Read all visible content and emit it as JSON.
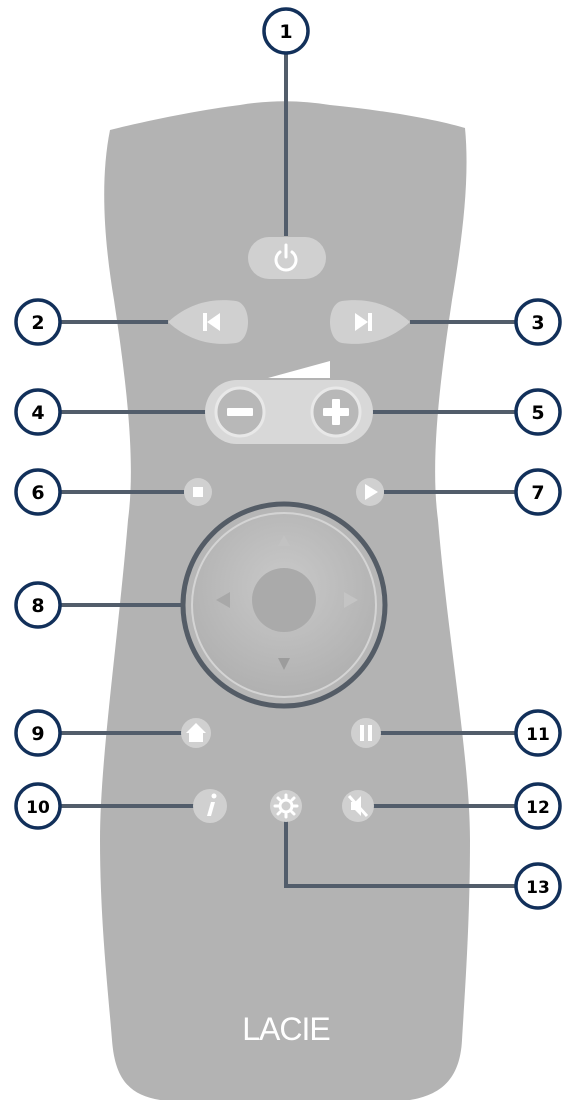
{
  "brand": {
    "logo_text": "LACIE"
  },
  "callouts": [
    {
      "number": "1",
      "target": "power-button"
    },
    {
      "number": "2",
      "target": "previous-button"
    },
    {
      "number": "3",
      "target": "next-button"
    },
    {
      "number": "4",
      "target": "volume-down-button"
    },
    {
      "number": "5",
      "target": "volume-up-button"
    },
    {
      "number": "6",
      "target": "stop-button"
    },
    {
      "number": "7",
      "target": "play-button"
    },
    {
      "number": "8",
      "target": "navigation-pad"
    },
    {
      "number": "9",
      "target": "home-button"
    },
    {
      "number": "10",
      "target": "info-button"
    },
    {
      "number": "11",
      "target": "pause-button"
    },
    {
      "number": "12",
      "target": "mute-button"
    },
    {
      "number": "13",
      "target": "settings-button"
    }
  ],
  "colors": {
    "remote_body": "#b3b3b3",
    "button_fill": "#d0d0d0",
    "callout_ring": "#12305a",
    "leader_line": "#525d6b",
    "dpad_ring": "#545c66",
    "symbol": "#ffffff"
  }
}
